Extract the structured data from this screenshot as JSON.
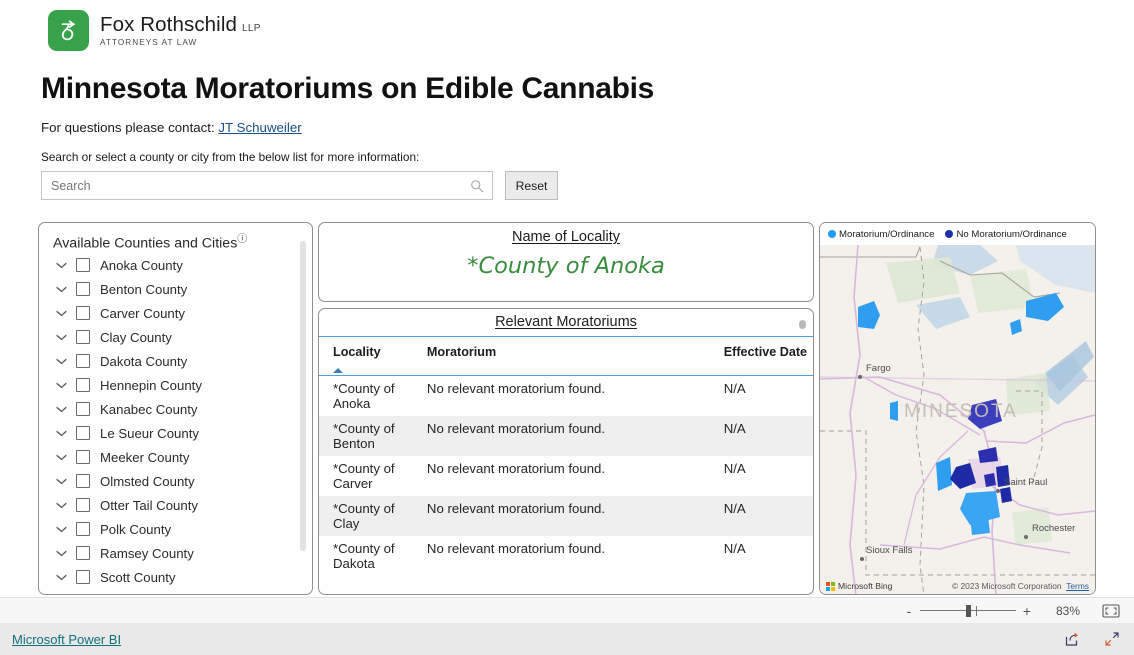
{
  "brand": {
    "name": "Fox Rothschild",
    "suffix": "LLP",
    "tagline": "ATTORNEYS AT LAW",
    "logo_icon": "fox-rothschild-logo-icon",
    "green": "#37a24a"
  },
  "header": {
    "title": "Minnesota Moratoriums on Edible Cannabis",
    "contact_prefix": "For questions please contact:",
    "contact_link": "JT Schuweiler",
    "search_help": "Search or select a county or city from the below list for more information:"
  },
  "search": {
    "value": "",
    "placeholder": "Search",
    "icon": "search-icon",
    "reset_label": "Reset"
  },
  "slicer": {
    "title": "Available Counties and Cities",
    "info_icon": "info-icon",
    "expand_icon": "chevron-down-icon",
    "items": [
      {
        "label": "Anoka County",
        "checked": false
      },
      {
        "label": "Benton County",
        "checked": false
      },
      {
        "label": "Carver County",
        "checked": false
      },
      {
        "label": "Clay County",
        "checked": false
      },
      {
        "label": "Dakota County",
        "checked": false
      },
      {
        "label": "Hennepin County",
        "checked": false
      },
      {
        "label": "Kanabec County",
        "checked": false
      },
      {
        "label": "Le Sueur County",
        "checked": false
      },
      {
        "label": "Meeker County",
        "checked": false
      },
      {
        "label": "Olmsted County",
        "checked": false
      },
      {
        "label": "Otter Tail County",
        "checked": false
      },
      {
        "label": "Polk County",
        "checked": false
      },
      {
        "label": "Ramsey County",
        "checked": false
      },
      {
        "label": "Scott County",
        "checked": false
      }
    ]
  },
  "locality": {
    "title": "Name of Locality",
    "value": "*County of Anoka",
    "value_color": "#3a8c3f"
  },
  "table": {
    "title": "Relevant Moratoriums",
    "columns": [
      "Locality",
      "Moratorium",
      "Effective Date"
    ],
    "sort_column": "Locality",
    "sort_direction": "ascending",
    "rows": [
      {
        "locality": "*County of Anoka",
        "moratorium": "No relevant moratorium found.",
        "effective_date": "N/A"
      },
      {
        "locality": "*County of Benton",
        "moratorium": "No relevant moratorium found.",
        "effective_date": "N/A"
      },
      {
        "locality": "*County of Carver",
        "moratorium": "No relevant moratorium found.",
        "effective_date": "N/A"
      },
      {
        "locality": "*County of Clay",
        "moratorium": "No relevant moratorium found.",
        "effective_date": "N/A"
      },
      {
        "locality": "*County of Dakota",
        "moratorium": "No relevant moratorium found.",
        "effective_date": "N/A"
      }
    ]
  },
  "map": {
    "legend": [
      {
        "label": "Moratorium/Ordinance",
        "color": "#1f9cf0"
      },
      {
        "label": "No Moratorium/Ordinance",
        "color": "#1b2fa8"
      }
    ],
    "state_label": "MINESOTA",
    "cities": [
      "Fargo",
      "Saint Paul",
      "Rochester",
      "Sioux Falls"
    ],
    "provider": "Microsoft Bing",
    "copyright": "© 2023 Microsoft Corporation",
    "terms_label": "Terms"
  },
  "zoombar": {
    "minus_label": "-",
    "plus_label": "+",
    "percent": "83%",
    "fit_icon": "fit-to-page-icon"
  },
  "footer": {
    "link": "Microsoft Power BI",
    "share_icon": "share-icon",
    "fullscreen_icon": "fullscreen-icon"
  }
}
